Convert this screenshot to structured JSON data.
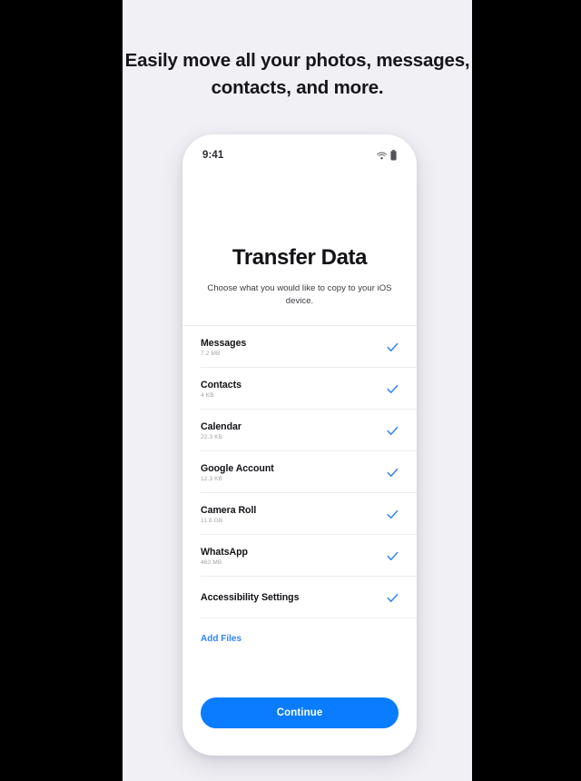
{
  "headline": "Easily move all your photos, messages, contacts, and more.",
  "phone": {
    "status": {
      "time": "9:41",
      "wifi_icon": "wifi-icon",
      "battery_icon": "battery-icon"
    },
    "screen": {
      "title": "Transfer Data",
      "subtitle": "Choose what you would like to copy to your iOS device.",
      "items": [
        {
          "label": "Messages",
          "size": "7.2 MB",
          "checked": true
        },
        {
          "label": "Contacts",
          "size": "4 KB",
          "checked": true
        },
        {
          "label": "Calendar",
          "size": "22.3 KB",
          "checked": true
        },
        {
          "label": "Google Account",
          "size": "12.3 KB",
          "checked": true
        },
        {
          "label": "Camera Roll",
          "size": "11.8 GB",
          "checked": true
        },
        {
          "label": "WhatsApp",
          "size": "463 MB",
          "checked": true
        },
        {
          "label": "Accessibility Settings",
          "size": "",
          "checked": true
        }
      ],
      "add_files_label": "Add Files",
      "continue_label": "Continue"
    }
  },
  "colors": {
    "accent_blue": "#0a7cff",
    "link_blue": "#2f84f7",
    "check_blue": "#2f84f7",
    "backdrop": "#f1f0f5",
    "letterbox": "#000000",
    "size_text": "#a3a3ab"
  }
}
